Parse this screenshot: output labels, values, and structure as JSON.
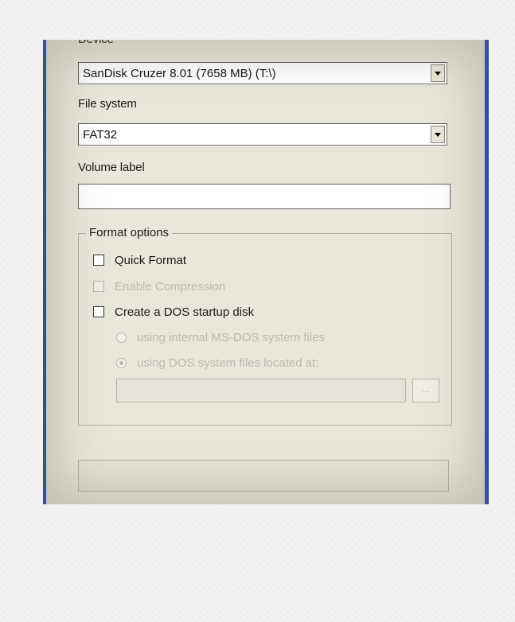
{
  "device": {
    "label": "Device",
    "selected": "SanDisk Cruzer 8.01 (7658 MB) (T:\\)"
  },
  "file_system": {
    "label": "File system",
    "selected": "FAT32"
  },
  "volume_label": {
    "label": "Volume label",
    "value": ""
  },
  "format_options": {
    "title": "Format options",
    "quick_format": {
      "label": "Quick Format",
      "checked": false,
      "enabled": true
    },
    "enable_compression": {
      "label": "Enable Compression",
      "checked": false,
      "enabled": false
    },
    "dos_startup": {
      "label": "Create a DOS startup disk",
      "checked": false,
      "enabled": true
    },
    "radio_internal": {
      "label": "using internal MS-DOS system files",
      "selected": false,
      "enabled": false
    },
    "radio_located": {
      "label": "using DOS system files located at:",
      "selected": true,
      "enabled": false
    },
    "path_value": "",
    "browse_label": "..."
  },
  "progress": {
    "value": 0
  },
  "colors": {
    "frame_border": "#1f3fb8",
    "dialog_bg": "#e9e7dc"
  }
}
